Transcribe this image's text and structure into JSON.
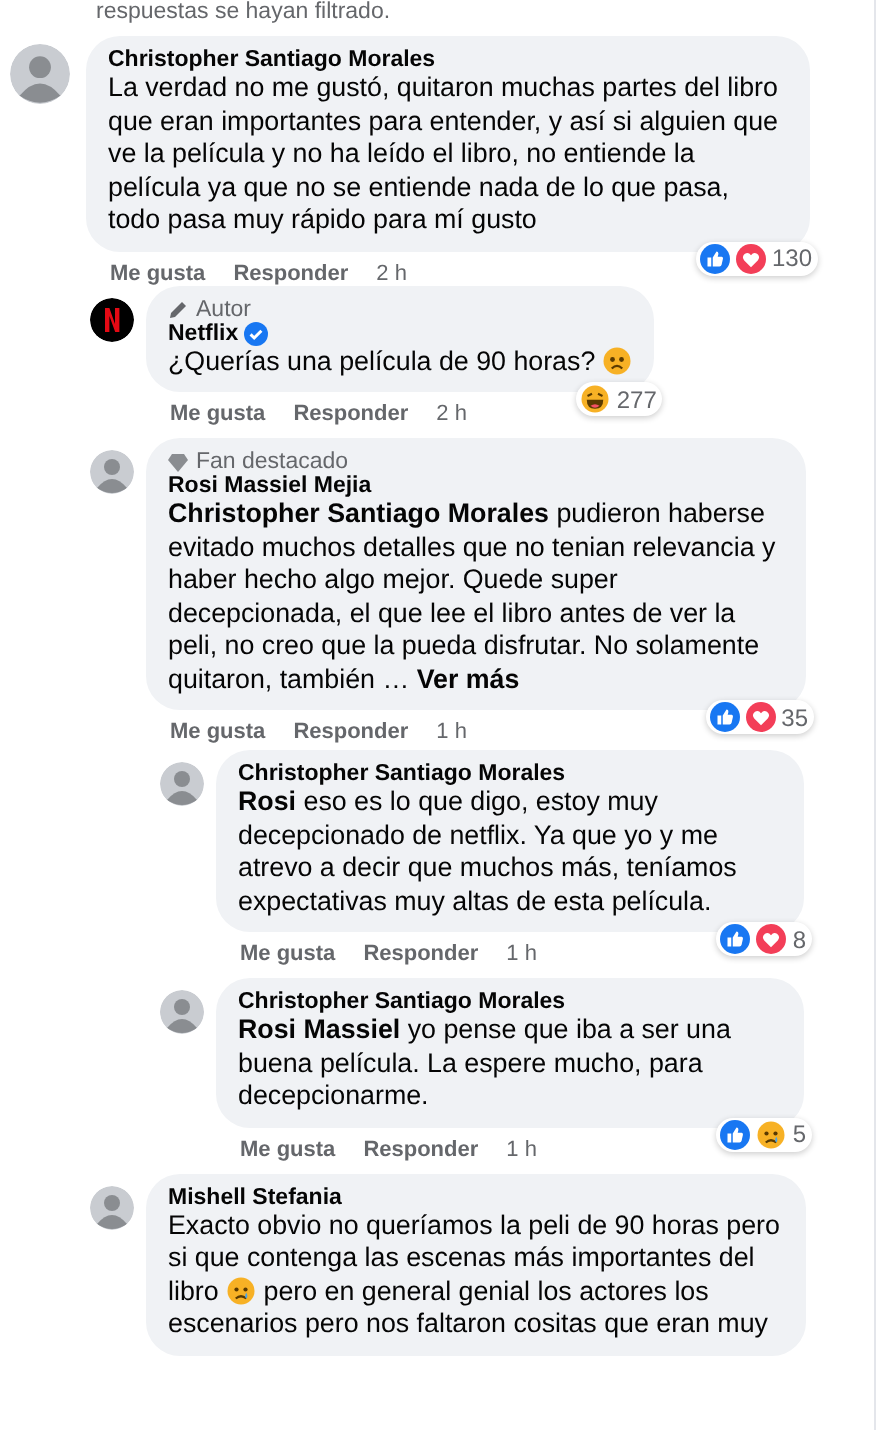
{
  "filter_notice": "respuestas se hayan filtrado.",
  "comments": [
    {
      "author": "Christopher Santiago Morales",
      "body": [
        {
          "kind": "text",
          "text": "La verdad no me gustó, quitaron muchas partes del libro que eran importantes para entender, y así si alguien que ve la película y no ha leído el libro, no entiende la película ya que no se entiende nada de lo que pasa, todo pasa muy rápido para mí gusto"
        }
      ],
      "reactions": [
        {
          "kind": "like"
        },
        {
          "kind": "love"
        }
      ],
      "reaction_count": "130",
      "actions": [
        "Me gusta",
        "Responder"
      ],
      "time": "2 h",
      "children": [
        {
          "author": "Netflix",
          "verified": true,
          "brand_avatar": true,
          "badge": {
            "kind": "author",
            "label": "Autor"
          },
          "body": [
            {
              "kind": "text",
              "text": "¿Querías una película de 90 horas? "
            },
            {
              "kind": "worried_emoji"
            }
          ],
          "reactions": [
            {
              "kind": "haha"
            }
          ],
          "reaction_count": "277",
          "actions": [
            "Me gusta",
            "Responder"
          ],
          "time": "2 h"
        },
        {
          "author": "Rosi Massiel Mejia",
          "badge": {
            "kind": "fan",
            "label": "Fan destacado"
          },
          "body": [
            {
              "kind": "text",
              "text": "**Christopher Santiago Morales** pudieron haberse evitado muchos detalles que no tenian relevancia y haber hecho algo mejor. Quede super decepcionada, el que lee el libro antes de ver la peli, no creo que la pueda disfrutar. No solamente quitaron, también … "
            }
          ],
          "see_more": "Ver más",
          "reactions": [
            {
              "kind": "like"
            },
            {
              "kind": "love"
            }
          ],
          "reaction_count": "35",
          "actions": [
            "Me gusta",
            "Responder"
          ],
          "time": "1 h",
          "children": [
            {
              "author": "Christopher Santiago Morales",
              "body": [
                {
                  "kind": "text",
                  "text": "**Rosi** eso es lo que digo, estoy muy decepcionado de netflix. Ya que yo y me atrevo a decir que muchos más, teníamos expectativas muy altas de esta película."
                }
              ],
              "reactions": [
                {
                  "kind": "like"
                },
                {
                  "kind": "love"
                }
              ],
              "reaction_count": "8",
              "actions": [
                "Me gusta",
                "Responder"
              ],
              "time": "1 h"
            },
            {
              "author": "Christopher Santiago Morales",
              "body": [
                {
                  "kind": "text",
                  "text": "**Rosi Massiel** yo pense que iba a ser una buena película. La espere mucho, para decepcionarme."
                }
              ],
              "reactions": [
                {
                  "kind": "like"
                },
                {
                  "kind": "sad"
                }
              ],
              "reaction_count": "5",
              "actions": [
                "Me gusta",
                "Responder"
              ],
              "time": "1 h"
            }
          ]
        },
        {
          "author": "Mishell Stefania",
          "body": [
            {
              "kind": "text",
              "text": "Exacto obvio no queríamos la peli de 90 horas pero si que contenga las escenas más importantes del libro "
            },
            {
              "kind": "sad_emoji"
            },
            {
              "kind": "text",
              "text": " pero en general genial los actores los escenarios pero nos faltaron cositas que eran muy"
            }
          ]
        }
      ]
    }
  ]
}
